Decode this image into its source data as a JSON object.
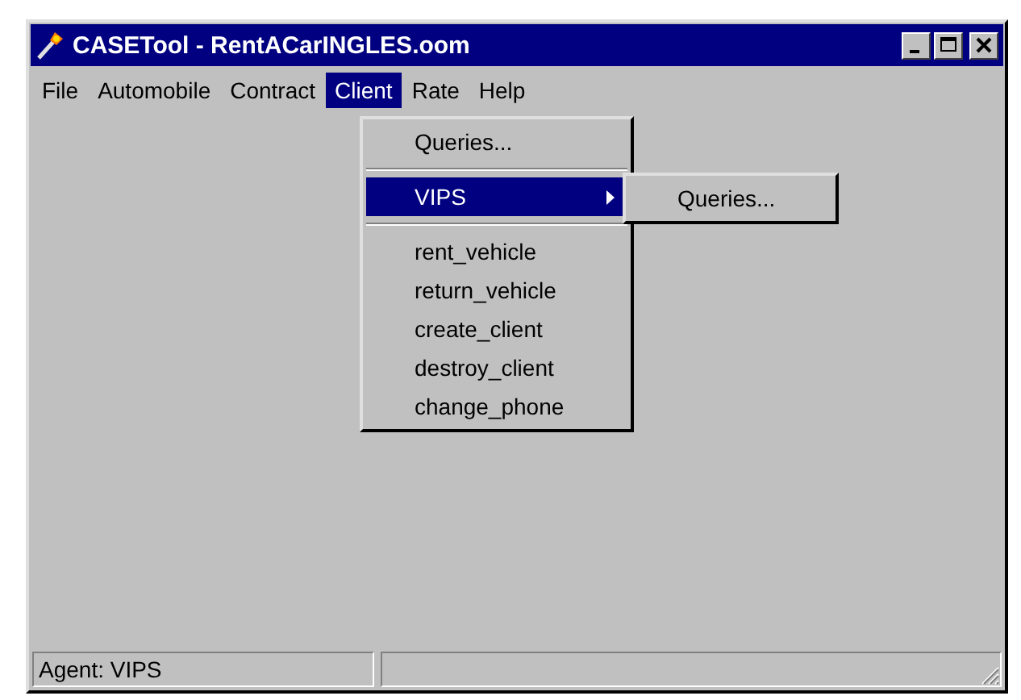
{
  "window": {
    "title": "CASETool - RentACarINGLES.oom"
  },
  "menu_bar": [
    {
      "label": "File",
      "selected": false
    },
    {
      "label": "Automobile",
      "selected": false
    },
    {
      "label": "Contract",
      "selected": false
    },
    {
      "label": "Client",
      "selected": true
    },
    {
      "label": "Rate",
      "selected": false
    },
    {
      "label": "Help",
      "selected": false
    }
  ],
  "dropdown": {
    "items": [
      {
        "kind": "item",
        "label": "Queries...",
        "selected": false
      },
      {
        "kind": "separator"
      },
      {
        "kind": "submenu",
        "label": "VIPS",
        "selected": true
      },
      {
        "kind": "separator"
      },
      {
        "kind": "item",
        "label": "rent_vehicle",
        "selected": false
      },
      {
        "kind": "item",
        "label": "return_vehicle",
        "selected": false
      },
      {
        "kind": "item",
        "label": "create_client",
        "selected": false
      },
      {
        "kind": "item",
        "label": "destroy_client",
        "selected": false
      },
      {
        "kind": "item",
        "label": "change_phone",
        "selected": false
      }
    ]
  },
  "submenu": {
    "items": [
      {
        "kind": "item",
        "label": "Queries...",
        "selected": false
      }
    ]
  },
  "status_bar": {
    "panes": [
      "Agent: VIPS"
    ]
  }
}
